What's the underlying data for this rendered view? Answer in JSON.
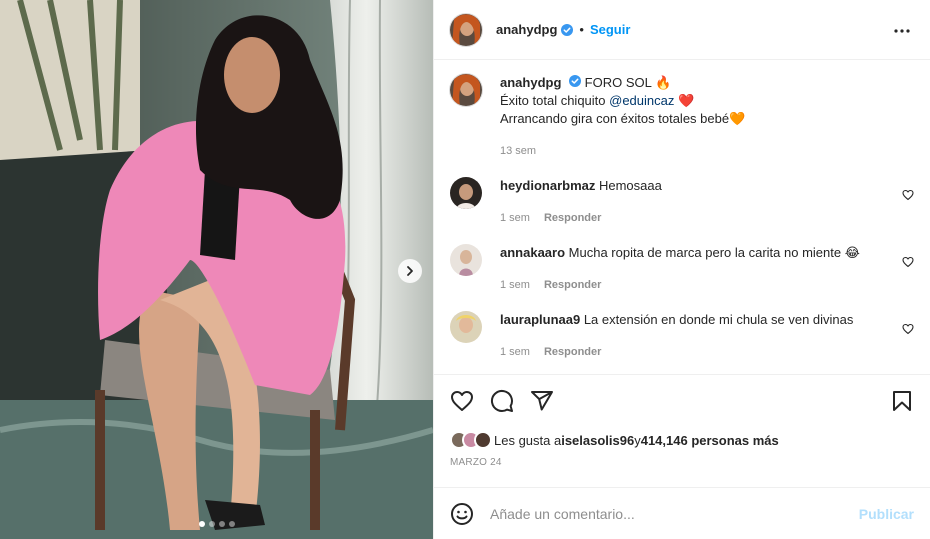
{
  "post": {
    "username": "anahydpg",
    "follow_label": "Seguir",
    "separator": "•",
    "caption": {
      "username": "anahydpg",
      "line1_text": "FORO SOL 🔥",
      "line2_prefix": "Éxito total chiquito ",
      "line2_mention": "@eduincaz",
      "line2_suffix": " ❤️",
      "line3": "Arrancando gira con éxitos totales bebé🧡",
      "time": "13 sem"
    },
    "comments": [
      {
        "username": "heydionarbmaz",
        "text": "Hemosaaa",
        "time": "1 sem",
        "reply_label": "Responder"
      },
      {
        "username": "annakaaro",
        "text": "Mucha ropita de marca pero la carita no miente 😂",
        "time": "1 sem",
        "reply_label": "Responder"
      },
      {
        "username": "lauraplunaa9",
        "text": "La extensión en donde mi chula se ven divinas",
        "time": "1 sem",
        "reply_label": "Responder"
      }
    ],
    "likes": {
      "prefix": "Les gusta a ",
      "user": "iselasolis96",
      "middle": " y ",
      "count": "414,146 personas más"
    },
    "date": "MARZO 24",
    "composer": {
      "placeholder": "Añade un comentario...",
      "publish_label": "Publicar"
    },
    "carousel": {
      "total_slides": 4,
      "current_slide": 1
    },
    "icons": {
      "verified": "verified-badge-icon",
      "more": "more-options-icon",
      "like": "heart-icon",
      "comment": "comment-icon",
      "share": "share-icon",
      "save": "bookmark-icon",
      "emoji": "emoji-icon",
      "next": "chevron-right-icon"
    },
    "colors": {
      "link_blue": "#0095f6",
      "verified_blue": "#3897f0",
      "publish_disabled": "#b2dffc",
      "meta_gray": "#8e8e8e"
    }
  }
}
